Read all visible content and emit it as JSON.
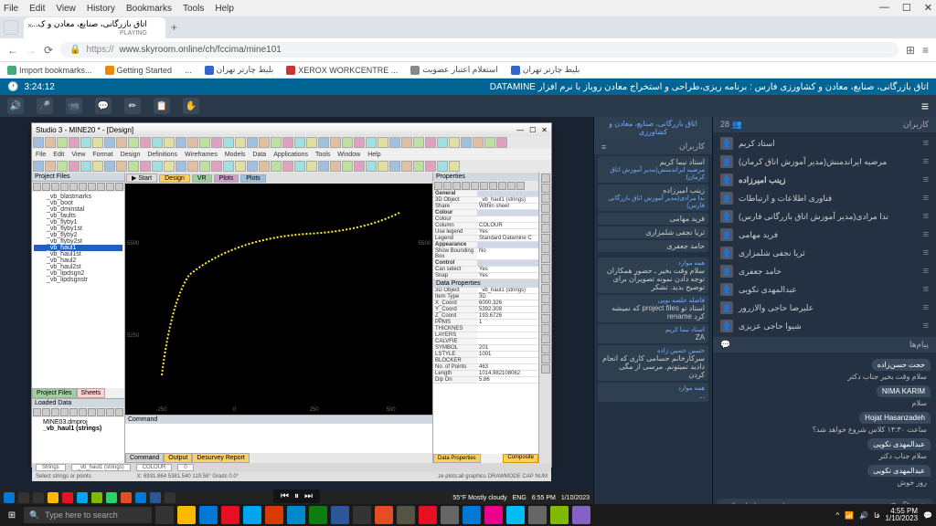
{
  "browser": {
    "menu": [
      "File",
      "Edit",
      "View",
      "History",
      "Bookmarks",
      "Tools",
      "Help"
    ],
    "window_controls": [
      "—",
      "☐",
      "✕"
    ],
    "tab_title": "اتاق بازرگانی، صنایع، معادن و ک...",
    "tab_subtitle": "PLAYING",
    "url_prefix": "https://",
    "url": "www.skyroom.online/ch/fccima/mine101",
    "bookmarks": [
      {
        "label": "Import bookmarks...",
        "color": "#4a7"
      },
      {
        "label": "Getting Started",
        "color": "#e80"
      },
      {
        "label": "...",
        "color": "#888"
      },
      {
        "label": "بلیط چارتر تهران",
        "color": "#36c"
      },
      {
        "label": "XEROX WORKCENTRE ...",
        "color": "#c33"
      },
      {
        "label": "استعلام اعتبار عضویت",
        "color": "#888"
      },
      {
        "label": "بلیط چارتر تهران",
        "color": "#36c"
      }
    ]
  },
  "webinar": {
    "timer": "3:24:12",
    "title": "اتاق بازرگانی، صنایع، معادن و کشاورزی فارس : برنامه ریزی،طراحی و استخراج معادن روباز با نرم افزار DATAMINE",
    "toolbar_icons": [
      "🔊",
      "🎤",
      "📹",
      "💬",
      "✏",
      "📋",
      "✋"
    ]
  },
  "users_panel": {
    "title": "کاربران",
    "count_label": "28",
    "presenter_label": "استاد نیما کریم",
    "list": [
      {
        "name": "استاد کریم"
      },
      {
        "name": "مرضیه ایراندمنش(مدیر آموزش اتاق کرمان)"
      },
      {
        "name": "زینب امیرزاده",
        "bold": true
      },
      {
        "name": "فناوری اطلاعات و ارتباطات"
      },
      {
        "name": "ندا مرادی(مدیر آموزش اتاق بازرگانی فارس)"
      },
      {
        "name": "فرید مهامی"
      },
      {
        "name": "ثریا نجفی شلمزاری"
      },
      {
        "name": "حامد جعفری"
      },
      {
        "name": "عبدالمهدی نکویی"
      },
      {
        "name": "علیرضا حاجی والازرور"
      },
      {
        "name": "شیوا حاجی عزیزی"
      }
    ]
  },
  "inner_users": {
    "title": "کاربران",
    "list": [
      {
        "name": "استاد نیما کریم",
        "sub": "مرضیه ایراندمنش(مدیر آموزش اتاق کرمان)"
      },
      {
        "name": "زینب امیرزاده",
        "sub": "ندا مرادی(مدیر آموزش اتاق بازرگانی فارس)"
      },
      {
        "name": "فرید مهامی"
      },
      {
        "name": "ثریا نجفی شلمزاری"
      },
      {
        "name": "حامد جعفری"
      }
    ]
  },
  "chat": {
    "title": "پیام‌ها",
    "messages": [
      {
        "name": "حجت حسن‌زاده",
        "text": "سلام وقت بخیر جناب دکتر"
      },
      {
        "name": "NIMA KARIM",
        "text": "سلام"
      },
      {
        "name": "Hojat Hasanzadeh",
        "text": "ساعت ۱۴:۳۰ کلاس شروع خواهد شد؟"
      },
      {
        "name": "عبدالمهدی نکویی",
        "text": "سلام جناب دکتر"
      },
      {
        "name": "عبدالمهدی نکویی",
        "text": "روز خوش"
      }
    ],
    "input_placeholder": "پیام خود را وارد کنید"
  },
  "inner_chat": {
    "items": [
      {
        "name": "همه موارد",
        "text": "سلام وقت بخیر ـ حضور همکاران توجه دادن نمونه تصویرآن برای توضیح بدید. تشکر"
      },
      {
        "name": "فاضله خلصه نویی",
        "text": "استاد تو project files که نمیشه کرد rename"
      },
      {
        "name": "استاد نیما کریم",
        "text": "ZA"
      },
      {
        "name": "حسین حسین زاده",
        "text": "سرکارخانم حسامی کاری که انجام دادید نمیتونم. مرسی از مگی کردن"
      },
      {
        "name": "همه موارد",
        "text": "..."
      }
    ]
  },
  "studio": {
    "title": "Studio 3 - MINE20 * - [Design]",
    "menu": [
      "File",
      "Edit",
      "View",
      "Format",
      "Design",
      "Definitions",
      "Wireframes",
      "Models",
      "Data",
      "Applications",
      "Tools",
      "Window",
      "Help"
    ],
    "project_files_title": "Project Files",
    "files": [
      "_vb_blastmarks",
      "_vb_boot",
      "_vb_dminstal",
      "_vb_faults",
      "_vb_flyby1",
      "_vb_flyby1st",
      "_vb_flyby2",
      "_vb_flyby2st",
      "_vb_haul1",
      "_vb_haul1st",
      "_vb_haul2",
      "_vb_haul2st",
      "_vb_lipdsgn2",
      "_vb_lipdsgnstr"
    ],
    "selected_file": "_vb_haul1",
    "pf_tabs": [
      "Project Files",
      "Sheets"
    ],
    "loaded_data_title": "Loaded Data",
    "loaded_items": [
      "MINE03.dmproj",
      "_vb_haul1 (strings)"
    ],
    "plot_tabs": [
      "Start",
      "Design",
      "VR",
      "Plots",
      "Plots"
    ],
    "axis_y": [
      "5500",
      "5250"
    ],
    "axis_x": [
      "-250",
      "0",
      "250",
      "500"
    ],
    "axis_right": [
      "5500"
    ],
    "command_title": "Command",
    "command_tabs": [
      "Command",
      "Output",
      "Desurvey Report"
    ],
    "props_title": "Properties",
    "props_general": [
      {
        "k": "3D Object",
        "v": "_vb_haul1 (strings)"
      },
      {
        "k": "Share",
        "v": "Within sheet"
      }
    ],
    "props_colour": [
      {
        "k": "Colour",
        "v": ""
      },
      {
        "k": "Column",
        "v": "COLOUR"
      },
      {
        "k": "Use legend",
        "v": "Yes"
      },
      {
        "k": "Legend",
        "v": "Standard Datamine C"
      }
    ],
    "props_appearance": [
      {
        "k": "Show Bounding Box",
        "v": "No"
      }
    ],
    "props_control": [
      {
        "k": "Can select",
        "v": "Yes"
      },
      {
        "k": "Snap",
        "v": "Yes"
      }
    ],
    "data_props_title": "Data Properties",
    "data_props": [
      {
        "k": "3D Object",
        "v": "_vb_haul1 (strings)"
      },
      {
        "k": "Item Type",
        "v": "3D"
      },
      {
        "k": "X_Coord",
        "v": "6000.326"
      },
      {
        "k": "Y_Coord",
        "v": "5392.308"
      },
      {
        "k": "Z_Coord",
        "v": "193.6726"
      },
      {
        "k": "PPMS",
        "v": "1"
      },
      {
        "k": "THICKNES",
        "v": ""
      },
      {
        "k": "LAYERS",
        "v": ""
      },
      {
        "k": "CALVFIE",
        "v": ""
      },
      {
        "k": "SYMBOL",
        "v": "201"
      },
      {
        "k": "LSTYLE",
        "v": "1001"
      },
      {
        "k": "BLOCKER",
        "v": ""
      },
      {
        "k": "No. of Points",
        "v": "463"
      },
      {
        "k": "Length",
        "v": "1014.982108062"
      },
      {
        "k": "Dip On",
        "v": "5.86"
      }
    ],
    "data_prop_tab": "Data Properties",
    "composite_btn": "Composite",
    "status_left": "Select strings or points",
    "status_coords": "X: 6931.864   5381.540   119.58° Grads 0.0°",
    "status_right": "ze plots:all graphics   DRAWMODE   CAP NUM",
    "status2_items": [
      "",
      "Strings",
      "_vb_haul1 (strings)",
      "COLOUR",
      "0"
    ]
  },
  "inner_taskbar": {
    "weather": "55°F  Mostly cloudy",
    "lang": "ENG",
    "time": "6:55 PM",
    "date": "1/10/2023"
  },
  "outer_taskbar": {
    "search_placeholder": "Type here to search",
    "time": "4:55 PM",
    "date": "1/10/2023"
  }
}
